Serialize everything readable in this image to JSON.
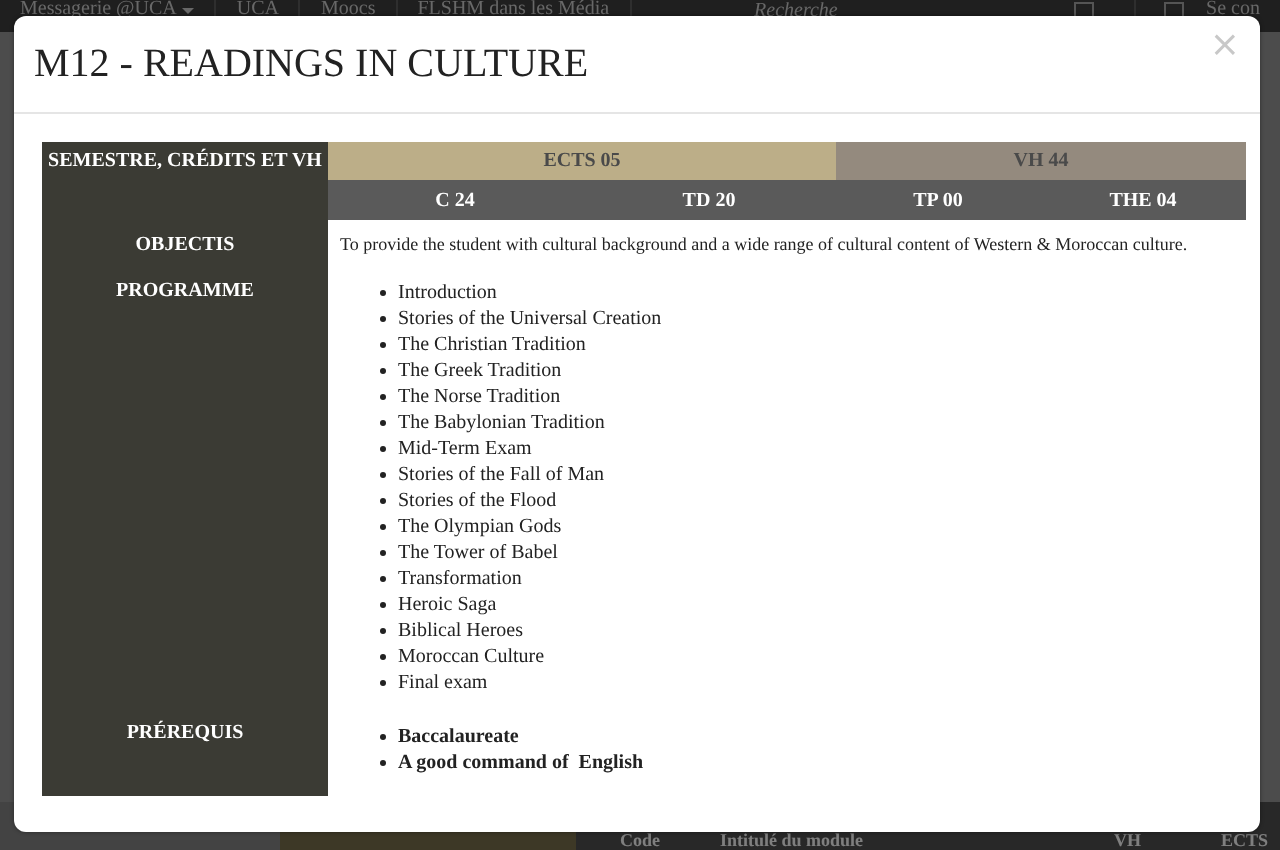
{
  "background_page": {
    "nav_items": [
      {
        "label": "Messagerie @UCA",
        "dropdown": true
      },
      {
        "label": "UCA",
        "dropdown": false
      },
      {
        "label": "Moocs",
        "dropdown": false
      },
      {
        "label": "FLSHM dans les Média",
        "dropdown": false
      }
    ],
    "search": {
      "placeholder": "Recherche"
    },
    "login": "Se con",
    "table_columns": [
      "Code",
      "Intitulé du module",
      "VH",
      "ECTS"
    ]
  },
  "modal": {
    "title": "M12 - READINGS IN CULTURE",
    "close": "×",
    "header": {
      "label": "SEMESTRE, CRÉDITS ET VH",
      "ects": "ECTS 05",
      "vh": "VH 44",
      "hours": [
        "C 24",
        "TD 20",
        "TP 00",
        "THE 04"
      ]
    },
    "sections": [
      {
        "label": "OBJECTIS",
        "kind": "text",
        "text": "To provide the student with cultural background and a wide range of cultural content of Western & Moroccan culture."
      },
      {
        "label": "PROGRAMME",
        "kind": "list",
        "items": [
          "Introduction",
          "Stories of the Universal Creation",
          "The Christian Tradition",
          "The Greek Tradition",
          "The Norse Tradition",
          "The Babylonian Tradition",
          "Mid-Term Exam",
          "Stories of the Fall of Man",
          "Stories of the Flood",
          "The Olympian Gods",
          "The Tower of Babel",
          "Transformation",
          "Heroic Saga",
          "Biblical Heroes",
          "Moroccan Culture",
          "Final exam"
        ]
      },
      {
        "label": "PRÉREQUIS",
        "kind": "bold_list",
        "items": [
          "Baccalaureate",
          "A good command of  English"
        ]
      }
    ]
  }
}
